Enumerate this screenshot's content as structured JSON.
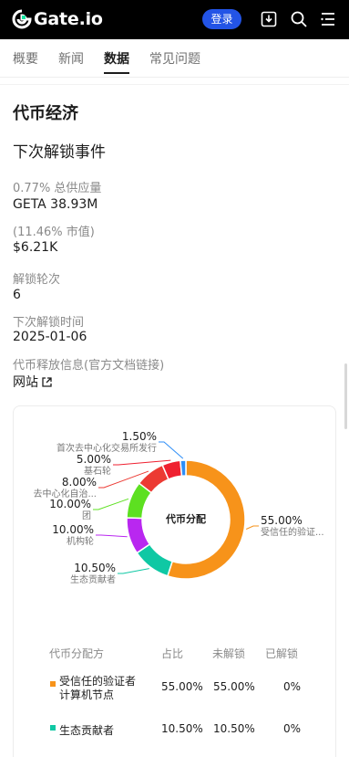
{
  "header": {
    "brand": "Gate.io",
    "login_label": "登录"
  },
  "tabs": [
    {
      "label": "概要"
    },
    {
      "label": "新闻"
    },
    {
      "label": "数据"
    },
    {
      "label": "常见问题"
    }
  ],
  "section_title": "代币经济",
  "next_unlock": {
    "title": "下次解锁事件",
    "supply_label": "0.77% 总供应量",
    "amount": "GETA 38.93M",
    "mcap_label": "(11.46% 市值)",
    "value": "$6.21K",
    "round_label": "解锁轮次",
    "round": "6",
    "time_label": "下次解锁时间",
    "time": "2025-01-06",
    "release_label": "代币释放信息(官方文档链接)",
    "website_label": "网站"
  },
  "chart_data": {
    "type": "pie",
    "title": "代币分配",
    "slices": [
      {
        "name": "受信任的验证...",
        "value": 55.0,
        "label": "55.00%",
        "color": "#f7931a"
      },
      {
        "name": "生态贡献者",
        "value": 10.5,
        "label": "10.50%",
        "color": "#0fc8a4"
      },
      {
        "name": "机构轮",
        "value": 10.0,
        "label": "10.00%",
        "color": "#b927f0"
      },
      {
        "name": "团",
        "value": 10.0,
        "label": "10.00%",
        "color": "#5de021"
      },
      {
        "name": "去中心化自治...",
        "value": 8.0,
        "label": "8.00%",
        "color": "#ec3a33"
      },
      {
        "name": "基石轮",
        "value": 5.0,
        "label": "5.00%",
        "color": "#ef2030"
      },
      {
        "name": "首次去中心化交易所发行",
        "value": 1.5,
        "label": "1.50%",
        "color": "#2e8ef7"
      }
    ]
  },
  "table": {
    "headers": [
      "代币分配方",
      "占比",
      "未解锁",
      "已解锁"
    ],
    "rows": [
      {
        "name_line1": "受信任的验证者",
        "name_line2": "计算机节点",
        "pct": "55.00%",
        "locked": "55.00%",
        "unlocked": "0%",
        "color": "#f7931a"
      },
      {
        "name_line1": "生态贡献者",
        "name_line2": "",
        "pct": "10.50%",
        "locked": "10.50%",
        "unlocked": "0%",
        "color": "#0fc8a4"
      }
    ]
  },
  "icons": [
    "logo-icon",
    "download-icon",
    "search-icon",
    "menu-icon",
    "external-link-icon"
  ]
}
